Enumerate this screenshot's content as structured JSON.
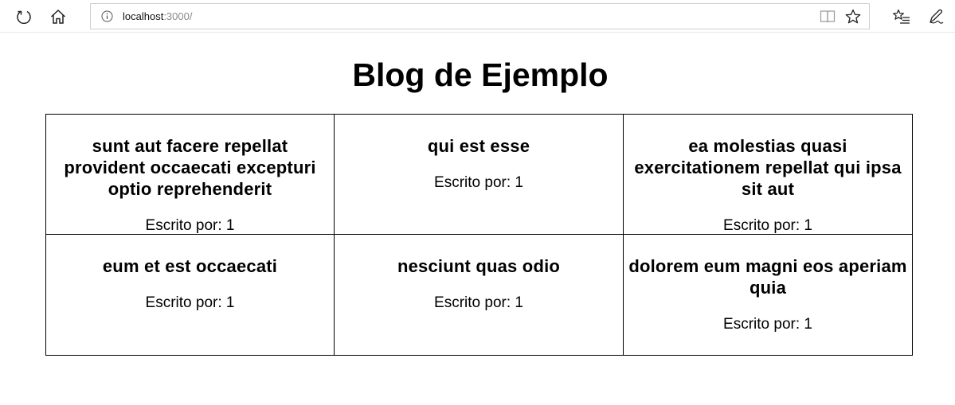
{
  "browser": {
    "url_host": "localhost",
    "url_path": ":3000/"
  },
  "page": {
    "title": "Blog de Ejemplo"
  },
  "posts": [
    {
      "title": "sunt aut facere repellat provident occaecati excepturi optio reprehenderit",
      "author": "Escrito por: 1"
    },
    {
      "title": "qui est esse",
      "author": "Escrito por: 1"
    },
    {
      "title": "ea molestias quasi exercitationem repellat qui ipsa sit aut",
      "author": "Escrito por: 1"
    },
    {
      "title": "eum et est occaecati",
      "author": "Escrito por: 1"
    },
    {
      "title": "nesciunt quas odio",
      "author": "Escrito por: 1"
    },
    {
      "title": "dolorem eum magni eos aperiam quia",
      "author": "Escrito por: 1"
    }
  ],
  "icons": {
    "refresh": "refresh-icon",
    "home": "home-icon",
    "info": "info-icon",
    "reading_view": "reading-view-icon",
    "favorite": "star-icon",
    "favorites_list": "favorites-list-icon",
    "notes": "pen-icon"
  }
}
